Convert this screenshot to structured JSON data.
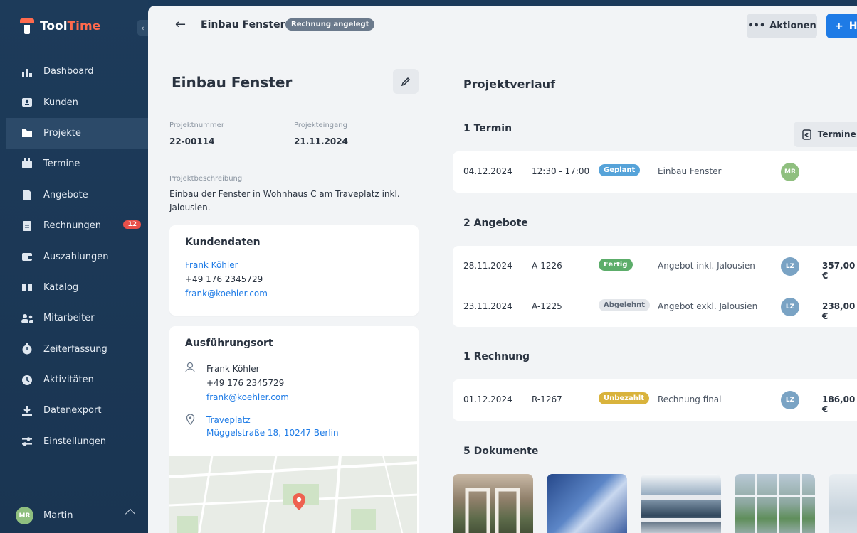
{
  "app": {
    "name_part1": "Tool",
    "name_part2": "Time"
  },
  "sidebar": {
    "items": [
      {
        "label": "Dashboard",
        "icon": "dashboard-icon"
      },
      {
        "label": "Kunden",
        "icon": "customers-icon"
      },
      {
        "label": "Projekte",
        "icon": "folder-icon",
        "active": true
      },
      {
        "label": "Termine",
        "icon": "calendar-icon"
      },
      {
        "label": "Angebote",
        "icon": "document-icon"
      },
      {
        "label": "Rechnungen",
        "icon": "invoice-icon",
        "badge": "12"
      },
      {
        "label": "Auszahlungen",
        "icon": "wallet-icon"
      },
      {
        "label": "Katalog",
        "icon": "book-icon"
      },
      {
        "label": "Mitarbeiter",
        "icon": "team-icon"
      },
      {
        "label": "Zeiterfassung",
        "icon": "stopwatch-icon"
      },
      {
        "label": "Aktivitäten",
        "icon": "history-icon"
      },
      {
        "label": "Datenexport",
        "icon": "download-icon"
      },
      {
        "label": "Einstellungen",
        "icon": "sliders-icon"
      }
    ],
    "user": {
      "initials": "MR",
      "name": "Martin"
    }
  },
  "header": {
    "title": "Einbau Fenster",
    "status": "Rechnung angelegt",
    "actions_label": "Aktionen",
    "primary_label": "H"
  },
  "project": {
    "title": "Einbau Fenster",
    "number_label": "Projektnummer",
    "number": "22-00114",
    "date_label": "Projekteingang",
    "date": "21.11.2024",
    "description_label": "Projektbeschreibung",
    "description": "Einbau der Fenster in Wohnhaus C am Traveplatz inkl. Jalousien."
  },
  "customer": {
    "heading": "Kundendaten",
    "name": "Frank Köhler",
    "phone": "+49 176 2345729",
    "email": "frank@koehler.com"
  },
  "location": {
    "heading": "Ausführungsort",
    "contact_name": "Frank Köhler",
    "contact_phone": "+49 176 2345729",
    "contact_email": "frank@koehler.com",
    "place": "Traveplatz",
    "address": "Müggelstraße 18, 10247 Berlin"
  },
  "timeline": {
    "heading": "Projektverlauf",
    "termine": {
      "heading": "1 Termin",
      "button": "Termine a",
      "rows": [
        {
          "date": "04.12.2024",
          "time": "12:30 - 17:00",
          "status": "Geplant",
          "title": "Einbau Fenster",
          "initials": "MR"
        }
      ]
    },
    "angebote": {
      "heading": "2 Angebote",
      "rows": [
        {
          "date": "28.11.2024",
          "number": "A-1226",
          "status": "Fertig",
          "title": "Angebot inkl. Jalousien",
          "initials": "LZ",
          "amount": "357,00 €"
        },
        {
          "date": "23.11.2024",
          "number": "A-1225",
          "status": "Abgelehnt",
          "title": "Angebot exkl. Jalousien",
          "initials": "LZ",
          "amount": "238,00 €"
        }
      ]
    },
    "rechnungen": {
      "heading": "1 Rechnung",
      "rows": [
        {
          "date": "01.12.2024",
          "number": "R-1267",
          "status": "Unbezahlt",
          "title": "Rechnung final",
          "initials": "LZ",
          "amount": "186,00 €"
        }
      ]
    },
    "dokumente": {
      "heading": "5 Dokumente"
    }
  },
  "colors": {
    "sidebar": "#1d3b5a",
    "accent": "#1e7be6",
    "brand": "#ff6a4d",
    "status_geplant": "#56a3d9",
    "status_fertig": "#5cad6a",
    "status_abgelehnt": "#e3e6ea",
    "status_unbezahlt": "#d9b33c"
  }
}
